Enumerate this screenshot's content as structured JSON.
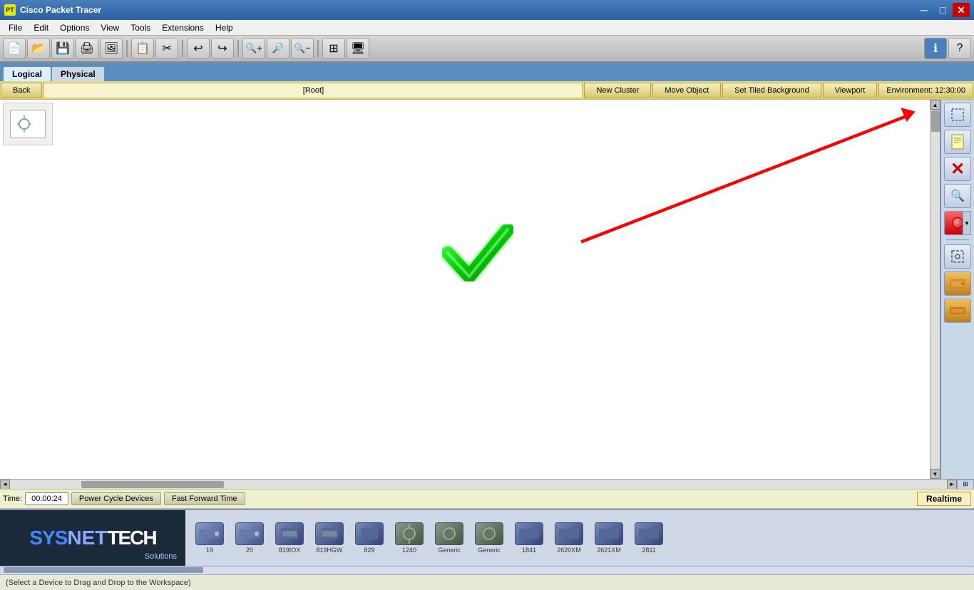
{
  "titlebar": {
    "app_title": "Cisco Packet Tracer",
    "minimize_label": "─",
    "maximize_label": "□",
    "close_label": "✕"
  },
  "menubar": {
    "items": [
      "File",
      "Edit",
      "Options",
      "View",
      "Tools",
      "Extensions",
      "Help"
    ]
  },
  "toolbar": {
    "buttons": [
      {
        "name": "new",
        "icon": "📄"
      },
      {
        "name": "open",
        "icon": "📂"
      },
      {
        "name": "save",
        "icon": "💾"
      },
      {
        "name": "print",
        "icon": "🖨"
      },
      {
        "name": "edit-bg",
        "icon": "🖼"
      },
      {
        "name": "copy",
        "icon": "📋"
      },
      {
        "name": "cut",
        "icon": "✂"
      },
      {
        "name": "undo",
        "icon": "↩"
      },
      {
        "name": "redo",
        "icon": "↪"
      },
      {
        "name": "zoom-in",
        "icon": "🔍"
      },
      {
        "name": "zoom-area",
        "icon": "🔎"
      },
      {
        "name": "zoom-out",
        "icon": "🔍"
      },
      {
        "name": "custom1",
        "icon": "⊞"
      },
      {
        "name": "custom2",
        "icon": "🖥"
      }
    ],
    "info_icon": "ℹ",
    "help_icon": "?"
  },
  "workspace_tabs": {
    "logical_label": "Logical",
    "physical_label": "Physical"
  },
  "navbar": {
    "back_label": "Back",
    "root_label": "[Root]",
    "new_cluster_label": "New Cluster",
    "move_object_label": "Move Object",
    "set_tiled_bg_label": "Set Tiled Background",
    "viewport_label": "Viewport",
    "environment_label": "Environment: 12:30:00"
  },
  "right_panel": {
    "buttons": [
      {
        "name": "select",
        "icon": "⬚"
      },
      {
        "name": "note",
        "icon": "📝"
      },
      {
        "name": "delete",
        "icon": "✕"
      },
      {
        "name": "search",
        "icon": "🔍"
      },
      {
        "name": "circle-red",
        "icon": "●"
      },
      {
        "name": "select2",
        "icon": "⬚"
      },
      {
        "name": "device1",
        "icon": "🟧"
      },
      {
        "name": "device2",
        "icon": "🟧"
      }
    ]
  },
  "workspace": {
    "checkmark": "✔"
  },
  "control_bar": {
    "time_label": "Time:",
    "time_value": "00:00:24",
    "power_cycle_label": "Power Cycle Devices",
    "fast_forward_label": "Fast Forward Time",
    "realtime_label": "Realtime"
  },
  "devices": [
    {
      "label": "19",
      "icon": "🔀"
    },
    {
      "label": "20",
      "icon": "🔀"
    },
    {
      "label": "819IOX",
      "icon": "🔌"
    },
    {
      "label": "819HGW",
      "icon": "🔌"
    },
    {
      "label": "829",
      "icon": "🔌"
    },
    {
      "label": "1240",
      "icon": "📶"
    },
    {
      "label": "Generic",
      "icon": "📶"
    },
    {
      "label": "Generic",
      "icon": "📶"
    },
    {
      "label": "1841",
      "icon": "🔌"
    },
    {
      "label": "2620XM",
      "icon": "🔌"
    },
    {
      "label": "2621XM",
      "icon": "🔌"
    },
    {
      "label": "2811",
      "icon": "🔌"
    }
  ],
  "statusbar": {
    "message": "(Select a Device to Drag and Drop to the Workspace)"
  }
}
